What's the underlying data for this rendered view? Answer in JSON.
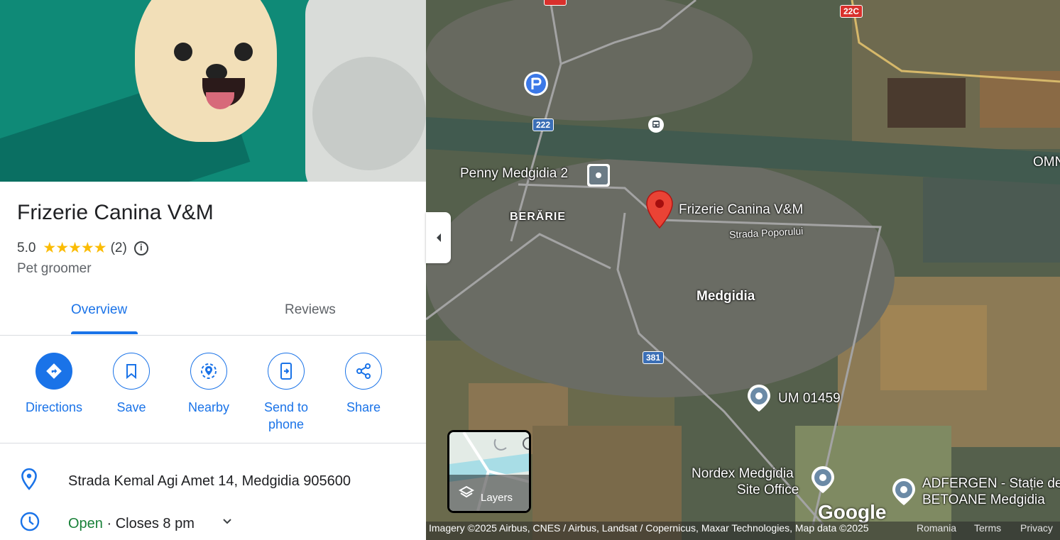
{
  "place": {
    "name": "Frizerie Canina V&M",
    "rating": "5.0",
    "stars": "★★★★★",
    "review_count": "(2)",
    "category": "Pet groomer"
  },
  "tabs": [
    {
      "label": "Overview",
      "active": true
    },
    {
      "label": "Reviews",
      "active": false
    }
  ],
  "actions": [
    {
      "label": "Directions",
      "icon": "directions-icon"
    },
    {
      "label": "Save",
      "icon": "bookmark-icon"
    },
    {
      "label": "Nearby",
      "icon": "nearby-icon"
    },
    {
      "label": "Send to phone",
      "icon": "send-to-phone-icon"
    },
    {
      "label": "Share",
      "icon": "share-icon"
    }
  ],
  "details": {
    "address": "Strada Kemal Agi Amet 14, Medgidia 905600",
    "open_status": "Open",
    "hours": " · Closes 8 pm"
  },
  "map": {
    "labels": {
      "penny": "Penny Medgidia 2",
      "place": "Frizerie Canina V&M",
      "berarie": "BERĂRIE",
      "street": "Strada Poporului",
      "city": "Medgidia",
      "um": "UM 01459",
      "nordex": "Nordex Medgidia",
      "nordex2": "Site Office",
      "adfergen": "ADFERGEN - Stație de",
      "adfergen2": "BETOANE Medgidia",
      "omn": "OMN"
    },
    "roads": {
      "r222": "222",
      "r381": "381",
      "r22c": "22C"
    },
    "layers_label": "Layers",
    "google": "Google",
    "attribution": "Imagery ©2025 Airbus, CNES / Airbus, Landsat / Copernicus, Maxar Technologies, Map data ©2025",
    "country": "Romania",
    "terms": "Terms",
    "privacy": "Privacy"
  },
  "colors": {
    "accent": "#1a73e8",
    "star": "#fbbc04",
    "open": "#188038",
    "pin": "#ea4335"
  }
}
